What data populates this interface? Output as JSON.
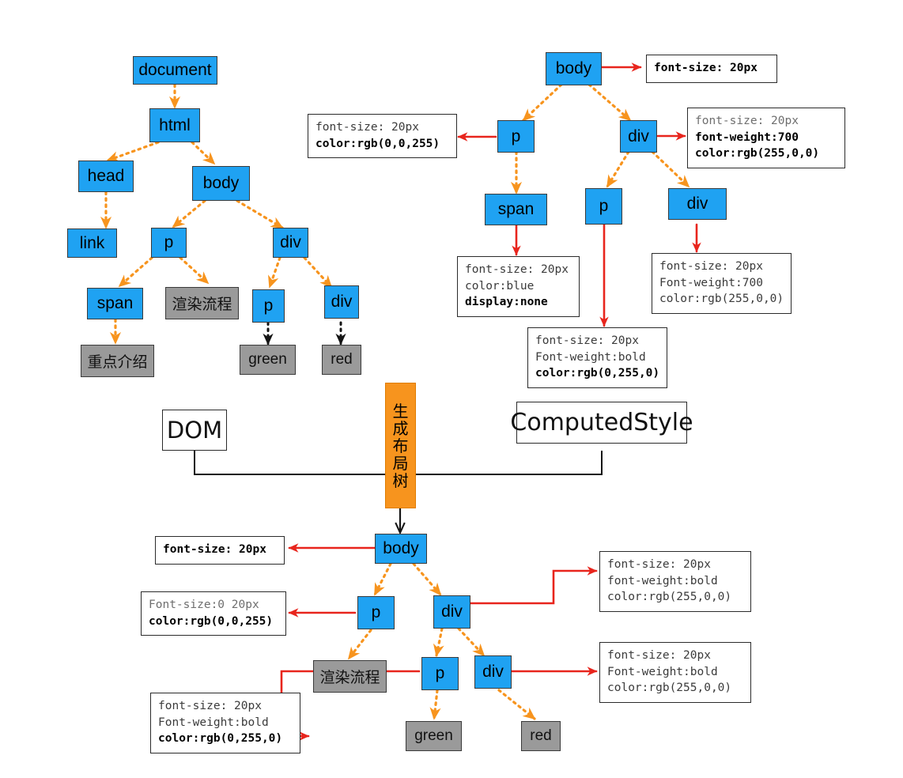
{
  "diagram": {
    "title": "DOM tree, ComputedStyle and layout tree generation",
    "colors": {
      "element_node": "#1fa2f2",
      "text_node": "#9a9a9a",
      "dom_edge": "#f7941e",
      "style_edge": "#e8251d",
      "text_edge": "#141414",
      "highlight_bar": "#f7941e"
    }
  },
  "dom_tree": {
    "caption": "DOM",
    "nodes": [
      {
        "id": "document",
        "label": "document"
      },
      {
        "id": "html",
        "label": "html"
      },
      {
        "id": "head",
        "label": "head"
      },
      {
        "id": "body",
        "label": "body"
      },
      {
        "id": "link",
        "label": "link"
      },
      {
        "id": "p1",
        "label": "p"
      },
      {
        "id": "div1",
        "label": "div"
      },
      {
        "id": "span",
        "label": "span"
      },
      {
        "id": "t_render",
        "label": "渲染流程"
      },
      {
        "id": "p2",
        "label": "p"
      },
      {
        "id": "div2",
        "label": "div"
      },
      {
        "id": "t_key",
        "label": "重点介绍"
      },
      {
        "id": "t_green",
        "label": "green"
      },
      {
        "id": "t_red",
        "label": "red"
      }
    ]
  },
  "computed_style_tree": {
    "caption": "ComputedStyle",
    "nodes": [
      {
        "id": "cs_body",
        "label": "body"
      },
      {
        "id": "cs_p1",
        "label": "p"
      },
      {
        "id": "cs_div1",
        "label": "div"
      },
      {
        "id": "cs_span",
        "label": "span"
      },
      {
        "id": "cs_p2",
        "label": "p"
      },
      {
        "id": "cs_div2",
        "label": "div"
      }
    ],
    "style_boxes": [
      {
        "id": "sb_body",
        "for": "body",
        "lines": [
          {
            "text": "font-size: 20px",
            "weight": "bold"
          }
        ]
      },
      {
        "id": "sb_p1",
        "for": "p",
        "lines": [
          {
            "text": "font-size: 20px",
            "weight": "normal"
          },
          {
            "text": "color:rgb(0,0,255)",
            "weight": "bold"
          }
        ]
      },
      {
        "id": "sb_div1",
        "for": "div",
        "lines": [
          {
            "text": "font-size: 20px",
            "weight": "inherited"
          },
          {
            "text": "font-weight:700",
            "weight": "bold"
          },
          {
            "text": "color:rgb(255,0,0)",
            "weight": "bold"
          }
        ]
      },
      {
        "id": "sb_span",
        "for": "span",
        "lines": [
          {
            "text": "font-size: 20px",
            "weight": "normal"
          },
          {
            "text": "color:blue",
            "weight": "normal"
          },
          {
            "text": "display:none",
            "weight": "bold"
          }
        ]
      },
      {
        "id": "sb_p2",
        "for": "p",
        "lines": [
          {
            "text": "font-size: 20px",
            "weight": "normal"
          },
          {
            "text": "Font-weight:bold",
            "weight": "normal"
          },
          {
            "text": "color:rgb(0,255,0)",
            "weight": "bold"
          }
        ]
      },
      {
        "id": "sb_div2",
        "for": "div",
        "lines": [
          {
            "text": "font-size: 20px",
            "weight": "normal"
          },
          {
            "text": "Font-weight:700",
            "weight": "normal"
          },
          {
            "text": "color:rgb(255,0,0)",
            "weight": "normal"
          }
        ]
      }
    ]
  },
  "process_label": {
    "text": "生成布局树",
    "chars": [
      "生",
      "成",
      "布",
      "局",
      "树"
    ]
  },
  "layout_tree": {
    "nodes": [
      {
        "id": "lt_body",
        "label": "body"
      },
      {
        "id": "lt_p1",
        "label": "p"
      },
      {
        "id": "lt_div1",
        "label": "div"
      },
      {
        "id": "lt_render",
        "label": "渲染流程"
      },
      {
        "id": "lt_p2",
        "label": "p"
      },
      {
        "id": "lt_div2",
        "label": "div"
      },
      {
        "id": "lt_green",
        "label": "green"
      },
      {
        "id": "lt_red",
        "label": "red"
      }
    ],
    "style_boxes": [
      {
        "id": "lsb_body",
        "for": "body",
        "lines": [
          {
            "text": "font-size: 20px",
            "weight": "bold"
          }
        ]
      },
      {
        "id": "lsb_p1",
        "for": "p",
        "lines": [
          {
            "text": "Font-size:0 20px",
            "weight": "normal"
          },
          {
            "text": "color:rgb(0,0,255)",
            "weight": "bold"
          }
        ]
      },
      {
        "id": "lsb_div1",
        "for": "div",
        "lines": [
          {
            "text": "font-size: 20px",
            "weight": "normal"
          },
          {
            "text": "font-weight:bold",
            "weight": "normal"
          },
          {
            "text": "color:rgb(255,0,0)",
            "weight": "normal"
          }
        ]
      },
      {
        "id": "lsb_div2",
        "for": "div",
        "lines": [
          {
            "text": "font-size: 20px",
            "weight": "normal"
          },
          {
            "text": "Font-weight:bold",
            "weight": "normal"
          },
          {
            "text": "color:rgb(255,0,0)",
            "weight": "normal"
          }
        ]
      },
      {
        "id": "lsb_p2",
        "for": "p",
        "lines": [
          {
            "text": "font-size: 20px",
            "weight": "normal"
          },
          {
            "text": "Font-weight:bold",
            "weight": "normal"
          },
          {
            "text": "color:rgb(0,255,0)",
            "weight": "bold"
          }
        ]
      }
    ]
  }
}
